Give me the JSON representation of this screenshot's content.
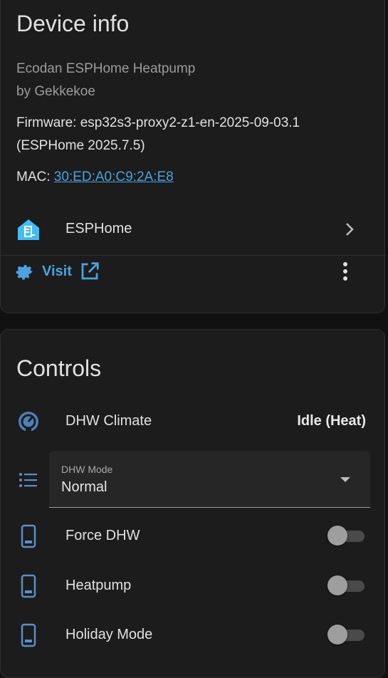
{
  "device_info": {
    "title": "Device info",
    "model": "Ecodan ESPHome Heatpump",
    "manufacturer": "by Gekkekoe",
    "firmware": "Firmware: esp32s3-proxy2-z1-en-2025-09-03.1",
    "firmware_version": "(ESPHome 2025.7.5)",
    "mac_label": "MAC: ",
    "mac_value": "30:ED:A0:C9:2A:E8",
    "integration": {
      "label": "ESPHome",
      "icon": "esphome-icon"
    },
    "visit_label": "Visit"
  },
  "controls": {
    "title": "Controls",
    "dhw_climate": {
      "label": "DHW Climate",
      "state": "Idle (Heat)",
      "icon": "thermostat-icon"
    },
    "dhw_mode": {
      "label": "DHW Mode",
      "value": "Normal",
      "icon": "list-icon"
    },
    "switches": [
      {
        "label": "Force DHW",
        "state": "off",
        "icon": "phone-icon"
      },
      {
        "label": "Heatpump",
        "state": "off",
        "icon": "phone-icon"
      },
      {
        "label": "Holiday Mode",
        "state": "off",
        "icon": "phone-icon"
      }
    ]
  },
  "colors": {
    "accent": "#4aa3df",
    "icon_blue": "#5b8fc9",
    "card_bg": "#1c1c1c",
    "page_bg": "#111111"
  }
}
